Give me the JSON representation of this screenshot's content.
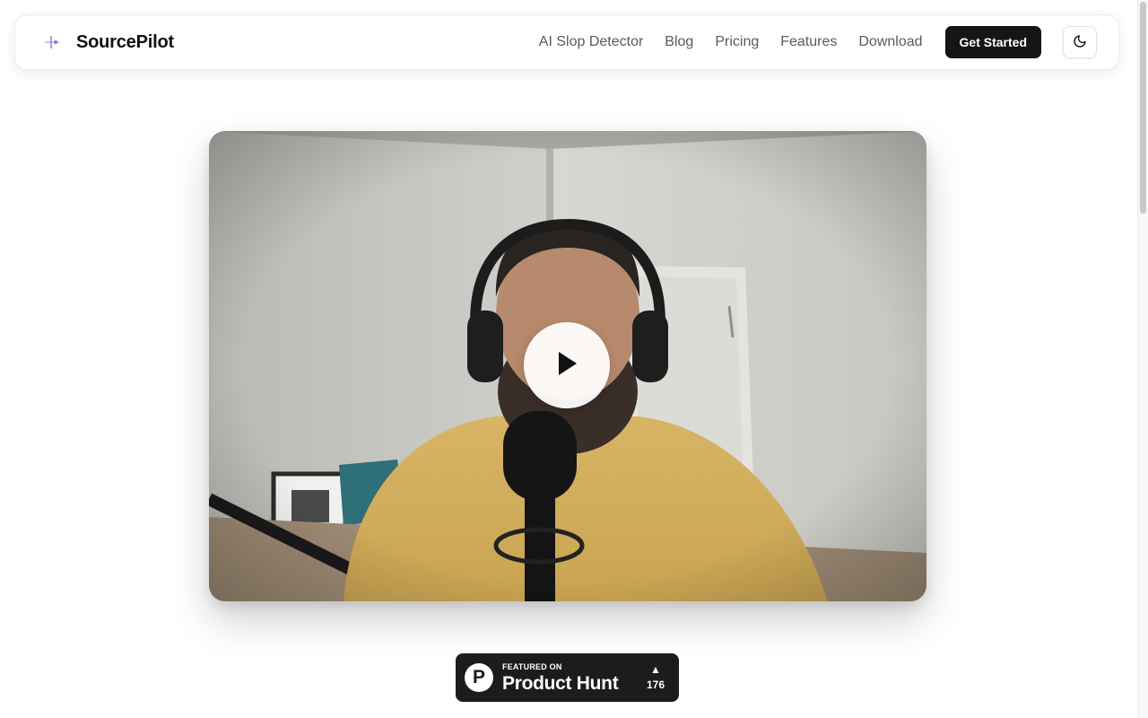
{
  "header": {
    "brand_name": "SourcePilot",
    "logo_icon": "spark-logo-icon",
    "nav": [
      {
        "label": "AI Slop Detector"
      },
      {
        "label": "Blog"
      },
      {
        "label": "Pricing"
      },
      {
        "label": "Features"
      },
      {
        "label": "Download"
      }
    ],
    "cta_label": "Get Started",
    "theme_toggle_icon": "moon-icon"
  },
  "video": {
    "play_icon": "play-icon"
  },
  "product_hunt": {
    "kicker": "FEATURED ON",
    "title": "Product Hunt",
    "upvote_icon": "triangle-up-icon",
    "votes": "176"
  },
  "colors": {
    "accent": "#9b7be0",
    "cta_bg": "#151515",
    "badge_bg": "#1c1c1c",
    "nav_text": "#5a5a5a"
  }
}
